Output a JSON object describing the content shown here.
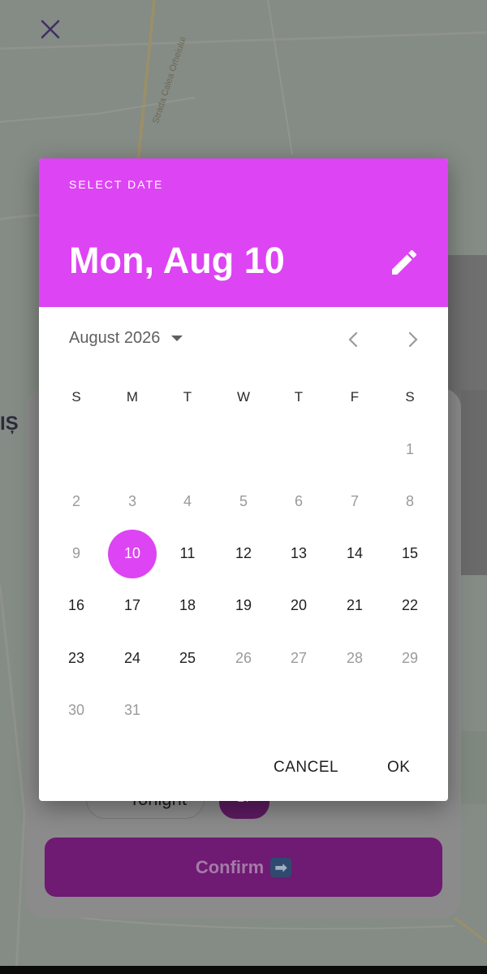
{
  "background": {
    "street_name": "Strada Calea Orheiului",
    "map_label": "IȘ",
    "chip_tonight_label": "Tonight",
    "chip_date_label": "17",
    "confirm_label": "Confirm",
    "confirm_icon": "arrow-right-icon"
  },
  "dialog": {
    "overline": "SELECT DATE",
    "selected_date": "Mon, Aug 10",
    "month_label": "August 2026",
    "weekdays": [
      "S",
      "M",
      "T",
      "W",
      "T",
      "F",
      "S"
    ],
    "first_weekday_index": 6,
    "days_in_month": 31,
    "selected_day": 10,
    "disabled_days": [
      1,
      2,
      3,
      4,
      5,
      6,
      7,
      8,
      9,
      26,
      27,
      28,
      29,
      30,
      31
    ],
    "cancel_label": "CANCEL",
    "ok_label": "OK",
    "accent_color": "#dd44f3"
  }
}
